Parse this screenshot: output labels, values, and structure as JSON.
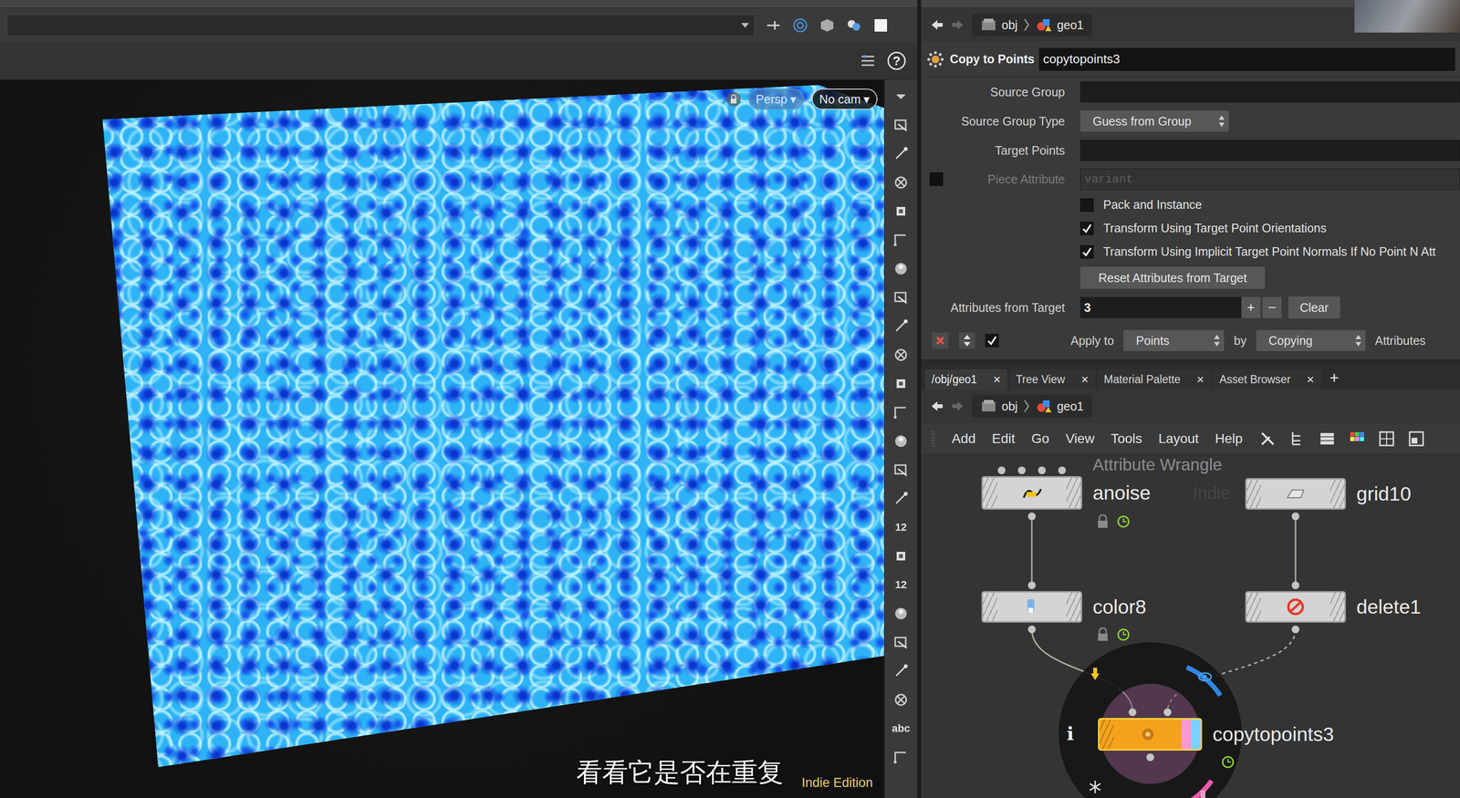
{
  "viewport": {
    "help": "?",
    "camera_buttons": [
      {
        "label": "Persp",
        "selected": true
      },
      {
        "label": "No cam",
        "selected": false
      }
    ],
    "menu_arrow": "▾",
    "subtitle": "看看它是否在重复",
    "edition": "Indie Edition"
  },
  "side_tools": [
    {
      "kind": "icon"
    },
    {
      "kind": "icon"
    },
    {
      "kind": "icon"
    },
    {
      "kind": "icon"
    },
    {
      "kind": "icon"
    },
    {
      "kind": "icon"
    },
    {
      "kind": "icon"
    },
    {
      "kind": "icon"
    },
    {
      "kind": "icon"
    },
    {
      "kind": "icon"
    },
    {
      "kind": "icon"
    },
    {
      "kind": "icon"
    },
    {
      "kind": "icon"
    },
    {
      "kind": "icon"
    },
    {
      "kind": "icon"
    },
    {
      "kind": "text",
      "label": "12"
    },
    {
      "kind": "icon"
    },
    {
      "kind": "text",
      "label": "12"
    },
    {
      "kind": "icon"
    },
    {
      "kind": "icon"
    },
    {
      "kind": "icon"
    },
    {
      "kind": "icon"
    },
    {
      "kind": "text",
      "label": "abc"
    },
    {
      "kind": "icon"
    }
  ],
  "parameter_pane": {
    "path": [
      "obj",
      "geo1"
    ],
    "node_type": "Copy to Points",
    "node_name": "copytopoints3",
    "params": [
      {
        "kind": "field",
        "label": "Source Group",
        "value": "",
        "disabled": false
      },
      {
        "kind": "select",
        "label": "Source Group Type",
        "value": "Guess from Group"
      },
      {
        "kind": "field",
        "label": "Target Points",
        "value": "",
        "disabled": false
      },
      {
        "kind": "field",
        "label": "Piece Attribute",
        "value": "variant",
        "disabled": true,
        "checked": false
      },
      {
        "kind": "checkbox",
        "label": "Pack and Instance",
        "checked": false
      },
      {
        "kind": "checkbox",
        "label": "Transform Using Target Point Orientations",
        "checked": true
      },
      {
        "kind": "checkbox",
        "label": "Transform Using Implicit Target Point Normals If No Point N Att",
        "checked": true
      },
      {
        "kind": "button",
        "label": "Reset Attributes from Target"
      },
      {
        "kind": "multiparm",
        "label": "Attributes from Target",
        "value": "3",
        "add": "+",
        "remove": "−",
        "clear": "Clear"
      },
      {
        "kind": "apply",
        "label": "Apply to",
        "checked": true,
        "value": "Points",
        "by": "by",
        "method": "Copying",
        "suffix": "Attributes"
      }
    ]
  },
  "network_pane": {
    "tabs": [
      {
        "label": "/obj/geo1",
        "selected": true
      },
      {
        "label": "Tree View",
        "selected": false
      },
      {
        "label": "Material Palette",
        "selected": false
      },
      {
        "label": "Asset Browser",
        "selected": false
      }
    ],
    "tab_close": "×",
    "new_tab": "+",
    "path": [
      "obj",
      "geo1"
    ],
    "menu": [
      "Add",
      "Edit",
      "Go",
      "View",
      "Tools",
      "Layout",
      "Help"
    ],
    "watermark": "Indie",
    "nodes": [
      {
        "name": "anoise",
        "type_label": "Attribute Wrangle",
        "inputs": 4,
        "selected": false,
        "locked": true,
        "time_dependent": true,
        "display_flag": false,
        "template_flag": false
      },
      {
        "name": "grid10",
        "type_label": "",
        "inputs": 0,
        "selected": false,
        "locked": false,
        "time_dependent": false,
        "display_flag": false,
        "template_flag": false
      },
      {
        "name": "color8",
        "type_label": "",
        "inputs": 1,
        "selected": false,
        "locked": true,
        "time_dependent": true,
        "display_flag": false,
        "template_flag": false
      },
      {
        "name": "delete1",
        "type_label": "",
        "inputs": 1,
        "selected": false,
        "locked": false,
        "time_dependent": false,
        "display_flag": false,
        "template_flag": false
      },
      {
        "name": "copytopoints3",
        "type_label": "",
        "inputs": 2,
        "selected": true,
        "locked": false,
        "time_dependent": true,
        "display_flag": true,
        "template_flag": true
      }
    ],
    "radial_menu": {
      "info": "i"
    }
  }
}
